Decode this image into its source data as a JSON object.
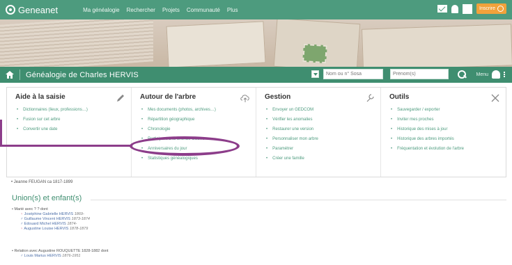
{
  "app": {
    "brand": "Geneanet",
    "nav": [
      "Ma généalogie",
      "Rechercher",
      "Projets",
      "Communauté",
      "Plus"
    ],
    "premium_label": "Inscrire"
  },
  "titlebar": {
    "title": "Généalogie de Charles HERVIS",
    "sosa_placeholder": "Nom ou n° Sosa",
    "prenom_placeholder": "Prénom(s)",
    "menu_label": "Menu"
  },
  "panel": {
    "columns": [
      {
        "title": "Aide à la saisie",
        "icon": "pencil-icon",
        "items": [
          "Dictionnaires (lieux, professions…)",
          "Fusion sur cet arbre",
          "Convertir une date"
        ]
      },
      {
        "title": "Autour de l'arbre",
        "icon": "cloud-upload-icon",
        "items": [
          "Mes documents (photos, archives…)",
          "Répartition géographique",
          "Chronologie",
          "Participant à la Grande Guerre",
          "Anniversaires du jour",
          "Statistiques généalogiques"
        ]
      },
      {
        "title": "Gestion",
        "icon": "wrench-icon",
        "items": [
          "Envoyer un GEDCOM",
          "Vérifier les anomalies",
          "Restaurer une version",
          "Personnaliser mon arbre",
          "Paramétrer",
          "Créer une famille"
        ]
      },
      {
        "title": "Outils",
        "icon": "tools-icon",
        "items": [
          "Sauvegarder / exporter",
          "Inviter mes proches",
          "Historique des mises à jour",
          "Historique des arbres importés",
          "Fréquentation et évolution de l'arbre"
        ]
      }
    ]
  },
  "content": {
    "marriage_line": "• Jeanne FEUGAN ca 1817-1899",
    "section_title": "Union(s) et enfant(s)",
    "family1": {
      "header": "• Marié avec ? ? dont",
      "children": [
        {
          "sex": "F",
          "name": "Joséphine Gabrielle HERVIS",
          "dates": "1869-"
        },
        {
          "sex": "M",
          "name": "Guillaume Vincent HERVIS",
          "dates": "1873-1874"
        },
        {
          "sex": "M",
          "name": "Edouard Michel HERVIS",
          "dates": "1874-"
        },
        {
          "sex": "F",
          "name": "Augustine Louise HERVIS",
          "dates": "1878-1879"
        }
      ]
    },
    "family2": {
      "header": "• Relation avec Augustine ROUQUETTE 1828-1882 dont",
      "children": [
        {
          "sex": "M",
          "name": "Louis Marius HERVIS",
          "dates": "1876-1951"
        }
      ]
    }
  },
  "colors": {
    "topbar": "#4d9b7e",
    "titlebar": "#3f8e70",
    "link": "#4d9b7e",
    "highlight": "#8c3d8a",
    "premium": "#f1a23b"
  }
}
